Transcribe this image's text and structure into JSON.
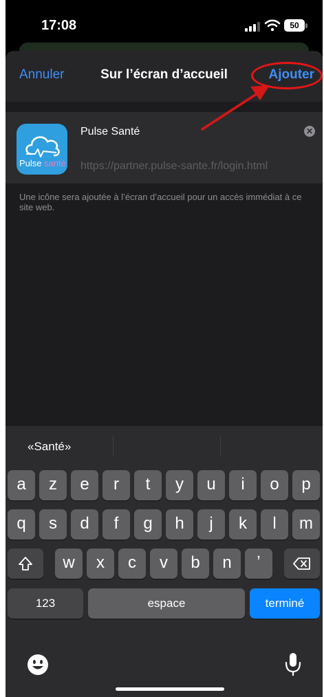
{
  "status": {
    "time": "17:08",
    "battery": "50"
  },
  "nav": {
    "cancel": "Annuler",
    "title": "Sur l’écran d’accueil",
    "add": "Ajouter"
  },
  "bookmark": {
    "icon_text_a": "Pulse",
    "icon_text_b": "santé",
    "name": "Pulse Santé",
    "url": "https://partner.pulse-sante.fr/login.html"
  },
  "note": "Une icône sera ajoutée à l’écran d’accueil pour un accès immédiat à ce site web.",
  "keyboard": {
    "suggestion": "«Santé»",
    "row1": [
      "a",
      "z",
      "e",
      "r",
      "t",
      "y",
      "u",
      "i",
      "o",
      "p"
    ],
    "row2": [
      "q",
      "s",
      "d",
      "f",
      "g",
      "h",
      "j",
      "k",
      "l",
      "m"
    ],
    "row3": [
      "w",
      "x",
      "c",
      "v",
      "b",
      "n",
      "ʼ"
    ],
    "numbers": "123",
    "space": "espace",
    "done": "terminé"
  },
  "colors": {
    "accent": "#3e8ef7",
    "annotation": "#e81515",
    "done_key": "#0a84ff"
  }
}
